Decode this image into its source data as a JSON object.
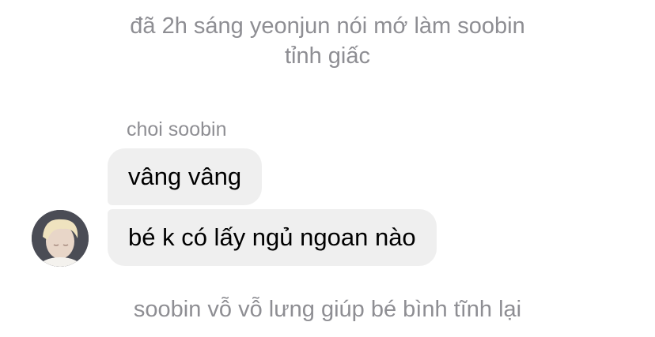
{
  "narration_top": {
    "line1": "đã 2h sáng yeonjun nói mớ làm soobin",
    "line2": "tỉnh giấc"
  },
  "sender": {
    "name": "choi soobin"
  },
  "messages": [
    {
      "text": "vâng vâng"
    },
    {
      "text": "bé k có lấy ngủ ngoan nào"
    }
  ],
  "narration_bottom": {
    "text": "soobin vỗ vỗ lưng giúp bé bình tĩnh lại"
  },
  "colors": {
    "background": "#ffffff",
    "bubble": "#efefef",
    "secondary_text": "#8e8e93",
    "primary_text": "#000000"
  }
}
